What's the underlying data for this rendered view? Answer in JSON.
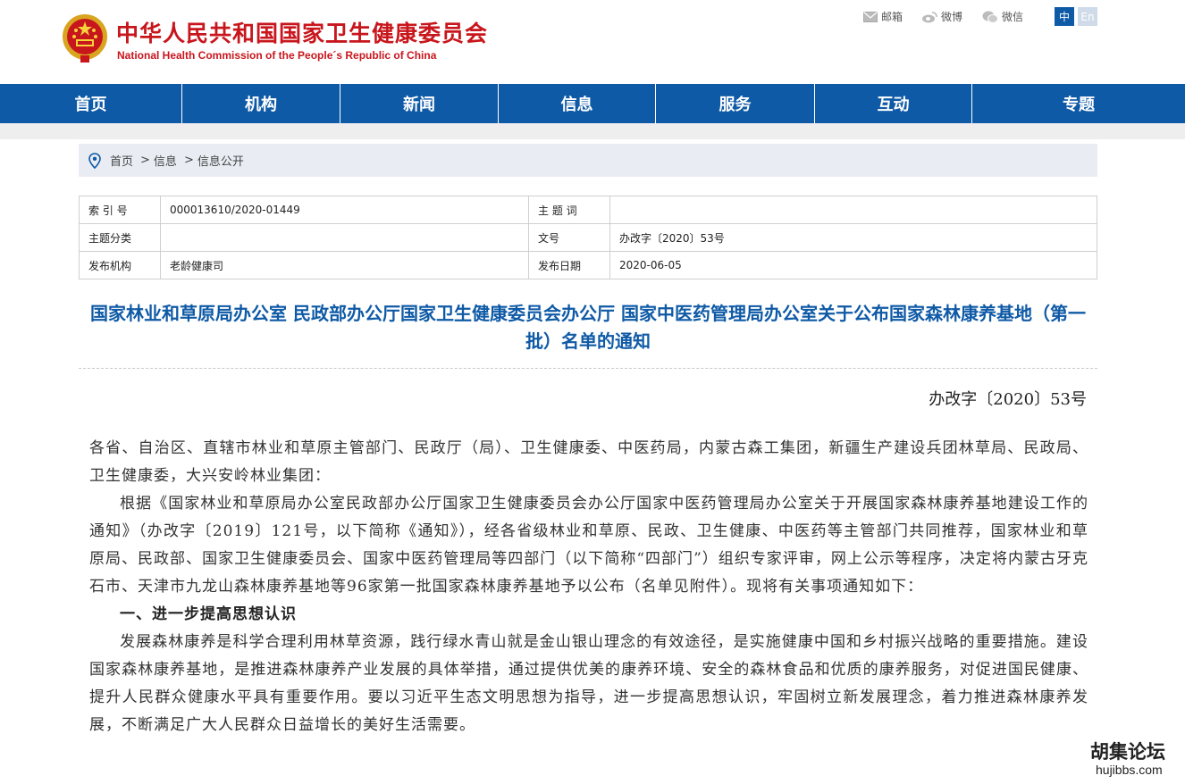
{
  "header": {
    "title": "中华人民共和国国家卫生健康委员会",
    "subtitle": "National Health Commission of the People´s Republic of China",
    "links": [
      {
        "label": "邮箱",
        "icon": "mail-icon"
      },
      {
        "label": "微博",
        "icon": "weibo-icon"
      },
      {
        "label": "微信",
        "icon": "wechat-icon"
      }
    ],
    "lang_zh": "中",
    "lang_en": "En"
  },
  "nav": {
    "items": [
      "首页",
      "机构",
      "新闻",
      "信息",
      "服务",
      "互动",
      "专题"
    ]
  },
  "breadcrumb": {
    "items": [
      "首页",
      "信息",
      "信息公开"
    ],
    "sep": ">"
  },
  "meta": {
    "index_label": "索 引 号",
    "index_value": "000013610/2020-01449",
    "keywords_label": "主 题 词",
    "keywords_value": "",
    "category_label": "主题分类",
    "category_value": "",
    "docno_label": "文号",
    "docno_value": "办改字〔2020〕53号",
    "org_label": "发布机构",
    "org_value": "老龄健康司",
    "date_label": "发布日期",
    "date_value": "2020-06-05"
  },
  "document": {
    "title": "国家林业和草原局办公室 民政部办公厅国家卫生健康委员会办公厅 国家中医药管理局办公室关于公布国家森林康养基地（第一批）名单的通知",
    "number": "办改字〔2020〕53号",
    "addressee": "各省、自治区、直辖市林业和草原主管部门、民政厅（局）、卫生健康委、中医药局，内蒙古森工集团，新疆生产建设兵团林草局、民政局、卫生健康委，大兴安岭林业集团：",
    "para1": "根据《国家林业和草原局办公室民政部办公厅国家卫生健康委员会办公厅国家中医药管理局办公室关于开展国家森林康养基地建设工作的通知》（办改字〔2019〕121号，以下简称《通知》），经各省级林业和草原、民政、卫生健康、中医药等主管部门共同推荐，国家林业和草原局、民政部、国家卫生健康委员会、国家中医药管理局等四部门（以下简称“四部门”）组织专家评审，网上公示等程序，决定将内蒙古牙克石市、天津市九龙山森林康养基地等96家第一批国家森林康养基地予以公布（名单见附件）。现将有关事项通知如下：",
    "heading1": "一、进一步提高思想认识",
    "para2": "发展森林康养是科学合理利用林草资源，践行绿水青山就是金山银山理念的有效途径，是实施健康中国和乡村振兴战略的重要措施。建设国家森林康养基地，是推进森林康养产业发展的具体举措，通过提供优美的康养环境、安全的森林食品和优质的康养服务，对促进国民健康、提升人民群众健康水平具有重要作用。要以习近平生态文明思想为指导，进一步提高思想认识，牢固树立新发展理念，着力推进森林康养发展，不断满足广大人民群众日益增长的美好生活需要。"
  },
  "watermark": {
    "cn": "胡集论坛",
    "en": "hujibbs.com"
  },
  "colors": {
    "brand_red": "#c8161d",
    "nav_blue": "#0f5aa6",
    "breadcrumb_bg": "#e9edf3"
  }
}
